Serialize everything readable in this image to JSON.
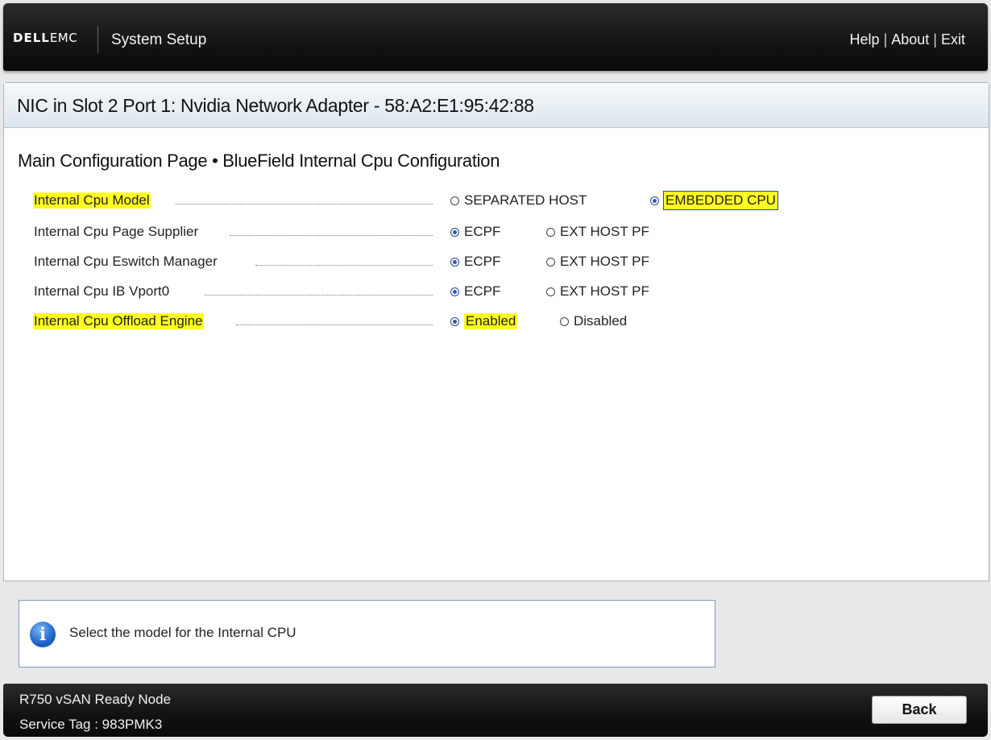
{
  "header": {
    "logo_brand": "DELL",
    "logo_sub": "EMC",
    "app_title": "System Setup",
    "links": [
      "Help",
      "About",
      "Exit"
    ]
  },
  "panel": {
    "title": "NIC in Slot 2 Port 1: Nvidia Network Adapter - 58:A2:E1:95:42:88",
    "page_title": "Main Configuration Page • BlueField Internal Cpu Configuration"
  },
  "settings": [
    {
      "label": "Internal Cpu Model",
      "highlighted": true,
      "options": [
        {
          "text": "SEPARATED HOST",
          "selected": false
        },
        {
          "text": "EMBEDDED CPU",
          "selected": true,
          "focused": true
        }
      ]
    },
    {
      "label": "Internal Cpu Page Supplier",
      "highlighted": false,
      "options": [
        {
          "text": "ECPF",
          "selected": true
        },
        {
          "text": "EXT HOST PF",
          "selected": false
        }
      ]
    },
    {
      "label": "Internal Cpu Eswitch Manager",
      "highlighted": false,
      "options": [
        {
          "text": "ECPF",
          "selected": true
        },
        {
          "text": "EXT HOST PF",
          "selected": false
        }
      ]
    },
    {
      "label": "Internal Cpu IB Vport0",
      "highlighted": false,
      "options": [
        {
          "text": "ECPF",
          "selected": true
        },
        {
          "text": "EXT HOST PF",
          "selected": false
        }
      ]
    },
    {
      "label": "Internal Cpu Offload Engine",
      "highlighted": true,
      "options": [
        {
          "text": "Enabled",
          "selected": true,
          "highlight": true
        },
        {
          "text": "Disabled",
          "selected": false
        }
      ]
    }
  ],
  "help": {
    "text": "Select the model for the Internal CPU"
  },
  "footer": {
    "model": "R750 vSAN Ready Node",
    "service_tag": "Service Tag : 983PMK3",
    "back_label": "Back"
  },
  "colors": {
    "highlight": "#ffff22",
    "radio_selected": "#2d56b5",
    "bar": "#111111"
  }
}
